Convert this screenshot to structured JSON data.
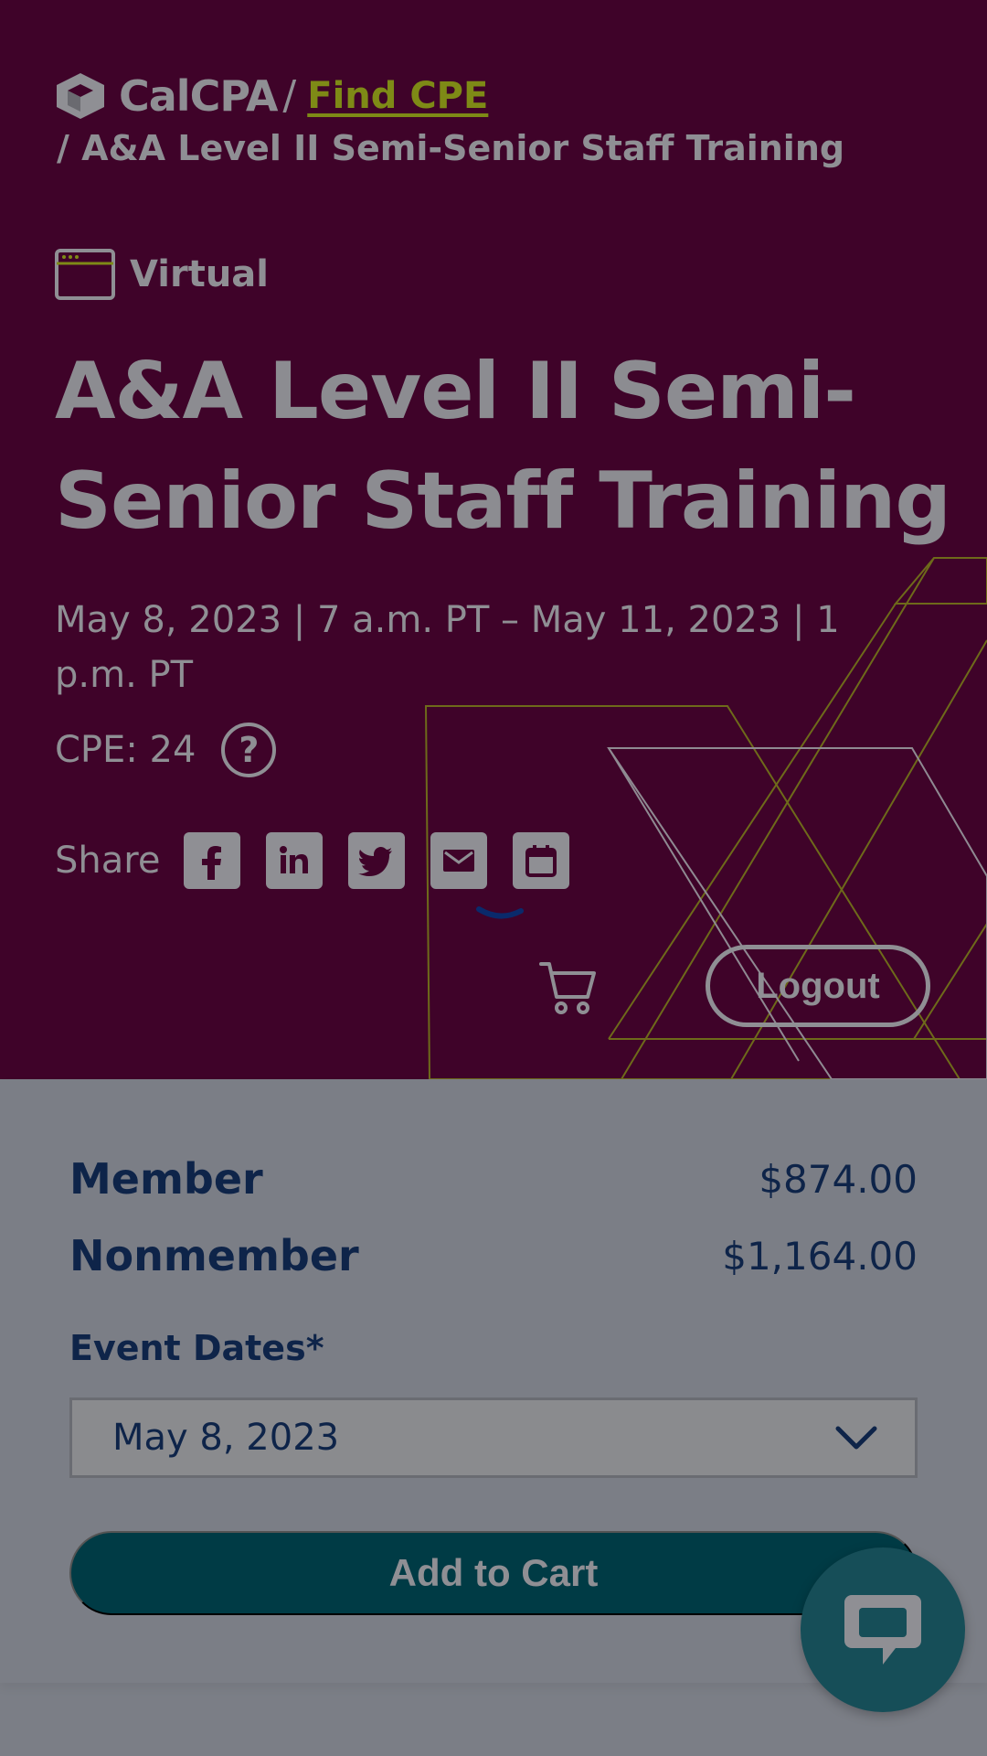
{
  "breadcrumb": {
    "logo_text": "CalCPA",
    "separator": "/",
    "link_label": "Find CPE",
    "current": "/ A&A Level II Semi-Senior Staff Training"
  },
  "event": {
    "format": "Virtual",
    "title": "A&A Level II Semi-Senior Staff Training",
    "dates": "May 8, 2023 | 7 a.m. PT – May 11, 2023 | 1 p.m. PT",
    "cpe": "CPE: 24",
    "help_glyph": "?"
  },
  "share": {
    "label": "Share",
    "buttons": [
      {
        "name": "facebook-icon"
      },
      {
        "name": "linkedin-icon"
      },
      {
        "name": "twitter-icon"
      },
      {
        "name": "email-icon"
      },
      {
        "name": "calendar-icon"
      }
    ]
  },
  "header_actions": {
    "logout_label": "Logout"
  },
  "pricing": {
    "member_label": "Member",
    "member_price": "$874.00",
    "nonmember_label": "Nonmember",
    "nonmember_price": "$1,164.00"
  },
  "event_dates": {
    "label": "Event Dates*",
    "selected": "May 8, 2023"
  },
  "cart": {
    "add_label": "Add to Cart"
  },
  "colors": {
    "hero_bg": "#3f0329",
    "accent_olive": "#7e8a16",
    "navy_text": "#0e2449",
    "teal_button": "#003b45",
    "chat_bubble": "#164e58"
  }
}
